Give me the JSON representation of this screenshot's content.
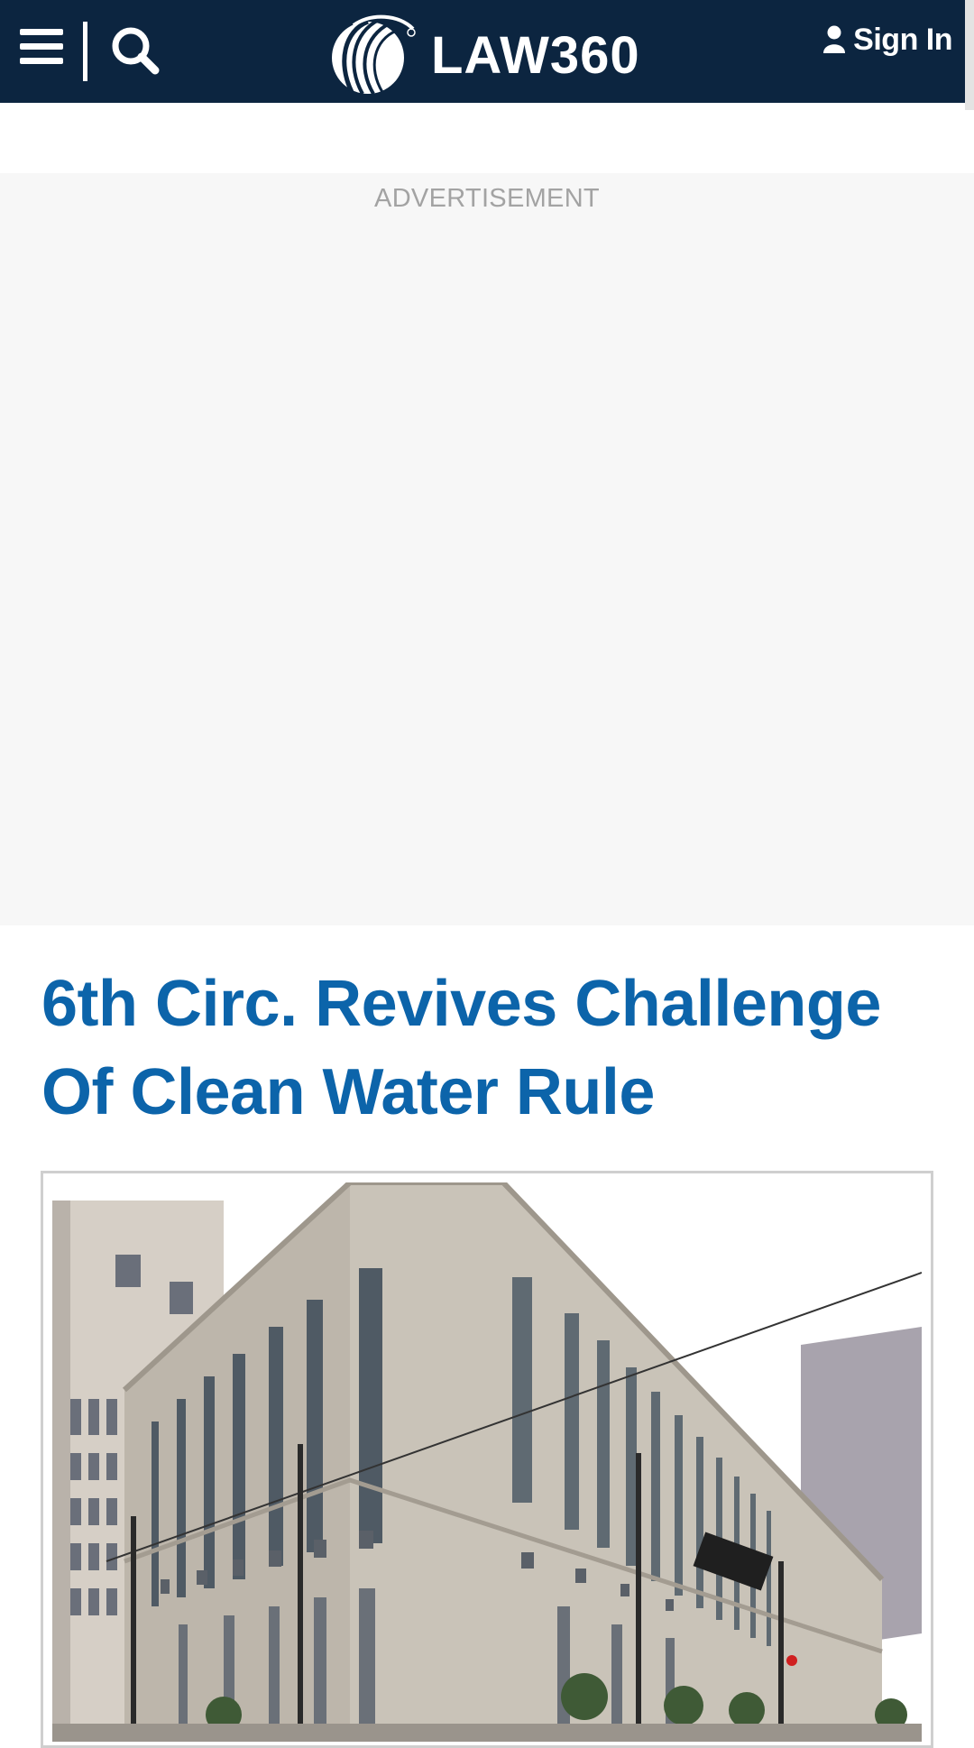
{
  "header": {
    "logo_text": "LAW360",
    "signin_label": "Sign In",
    "bg_color": "#0c2540",
    "icons": [
      "menu-icon",
      "search-icon",
      "user-icon"
    ]
  },
  "ad": {
    "label": "ADVERTISEMENT"
  },
  "article": {
    "title": "6th Circ. Revives Challenge Of Clean Water Rule",
    "title_color": "#0c64aa"
  }
}
